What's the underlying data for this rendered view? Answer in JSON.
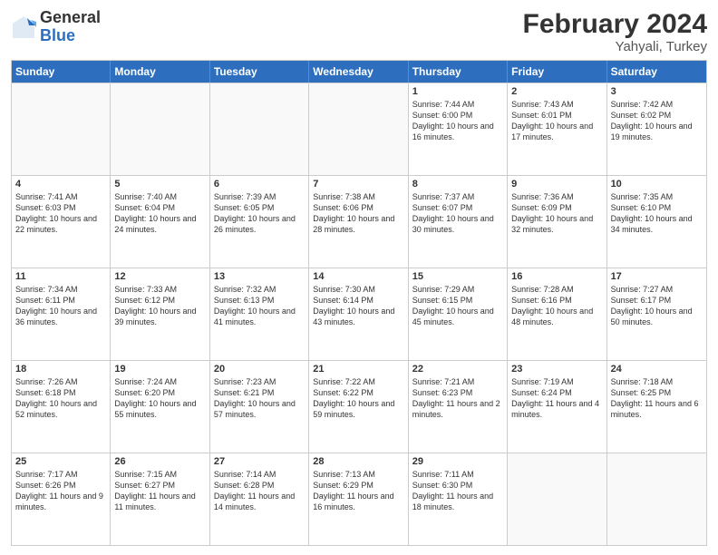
{
  "header": {
    "logo_general": "General",
    "logo_blue": "Blue",
    "cal_title": "February 2024",
    "cal_subtitle": "Yahyali, Turkey"
  },
  "weekdays": [
    "Sunday",
    "Monday",
    "Tuesday",
    "Wednesday",
    "Thursday",
    "Friday",
    "Saturday"
  ],
  "rows": [
    [
      {
        "day": "",
        "text": ""
      },
      {
        "day": "",
        "text": ""
      },
      {
        "day": "",
        "text": ""
      },
      {
        "day": "",
        "text": ""
      },
      {
        "day": "1",
        "text": "Sunrise: 7:44 AM\nSunset: 6:00 PM\nDaylight: 10 hours and 16 minutes."
      },
      {
        "day": "2",
        "text": "Sunrise: 7:43 AM\nSunset: 6:01 PM\nDaylight: 10 hours and 17 minutes."
      },
      {
        "day": "3",
        "text": "Sunrise: 7:42 AM\nSunset: 6:02 PM\nDaylight: 10 hours and 19 minutes."
      }
    ],
    [
      {
        "day": "4",
        "text": "Sunrise: 7:41 AM\nSunset: 6:03 PM\nDaylight: 10 hours and 22 minutes."
      },
      {
        "day": "5",
        "text": "Sunrise: 7:40 AM\nSunset: 6:04 PM\nDaylight: 10 hours and 24 minutes."
      },
      {
        "day": "6",
        "text": "Sunrise: 7:39 AM\nSunset: 6:05 PM\nDaylight: 10 hours and 26 minutes."
      },
      {
        "day": "7",
        "text": "Sunrise: 7:38 AM\nSunset: 6:06 PM\nDaylight: 10 hours and 28 minutes."
      },
      {
        "day": "8",
        "text": "Sunrise: 7:37 AM\nSunset: 6:07 PM\nDaylight: 10 hours and 30 minutes."
      },
      {
        "day": "9",
        "text": "Sunrise: 7:36 AM\nSunset: 6:09 PM\nDaylight: 10 hours and 32 minutes."
      },
      {
        "day": "10",
        "text": "Sunrise: 7:35 AM\nSunset: 6:10 PM\nDaylight: 10 hours and 34 minutes."
      }
    ],
    [
      {
        "day": "11",
        "text": "Sunrise: 7:34 AM\nSunset: 6:11 PM\nDaylight: 10 hours and 36 minutes."
      },
      {
        "day": "12",
        "text": "Sunrise: 7:33 AM\nSunset: 6:12 PM\nDaylight: 10 hours and 39 minutes."
      },
      {
        "day": "13",
        "text": "Sunrise: 7:32 AM\nSunset: 6:13 PM\nDaylight: 10 hours and 41 minutes."
      },
      {
        "day": "14",
        "text": "Sunrise: 7:30 AM\nSunset: 6:14 PM\nDaylight: 10 hours and 43 minutes."
      },
      {
        "day": "15",
        "text": "Sunrise: 7:29 AM\nSunset: 6:15 PM\nDaylight: 10 hours and 45 minutes."
      },
      {
        "day": "16",
        "text": "Sunrise: 7:28 AM\nSunset: 6:16 PM\nDaylight: 10 hours and 48 minutes."
      },
      {
        "day": "17",
        "text": "Sunrise: 7:27 AM\nSunset: 6:17 PM\nDaylight: 10 hours and 50 minutes."
      }
    ],
    [
      {
        "day": "18",
        "text": "Sunrise: 7:26 AM\nSunset: 6:18 PM\nDaylight: 10 hours and 52 minutes."
      },
      {
        "day": "19",
        "text": "Sunrise: 7:24 AM\nSunset: 6:20 PM\nDaylight: 10 hours and 55 minutes."
      },
      {
        "day": "20",
        "text": "Sunrise: 7:23 AM\nSunset: 6:21 PM\nDaylight: 10 hours and 57 minutes."
      },
      {
        "day": "21",
        "text": "Sunrise: 7:22 AM\nSunset: 6:22 PM\nDaylight: 10 hours and 59 minutes."
      },
      {
        "day": "22",
        "text": "Sunrise: 7:21 AM\nSunset: 6:23 PM\nDaylight: 11 hours and 2 minutes."
      },
      {
        "day": "23",
        "text": "Sunrise: 7:19 AM\nSunset: 6:24 PM\nDaylight: 11 hours and 4 minutes."
      },
      {
        "day": "24",
        "text": "Sunrise: 7:18 AM\nSunset: 6:25 PM\nDaylight: 11 hours and 6 minutes."
      }
    ],
    [
      {
        "day": "25",
        "text": "Sunrise: 7:17 AM\nSunset: 6:26 PM\nDaylight: 11 hours and 9 minutes."
      },
      {
        "day": "26",
        "text": "Sunrise: 7:15 AM\nSunset: 6:27 PM\nDaylight: 11 hours and 11 minutes."
      },
      {
        "day": "27",
        "text": "Sunrise: 7:14 AM\nSunset: 6:28 PM\nDaylight: 11 hours and 14 minutes."
      },
      {
        "day": "28",
        "text": "Sunrise: 7:13 AM\nSunset: 6:29 PM\nDaylight: 11 hours and 16 minutes."
      },
      {
        "day": "29",
        "text": "Sunrise: 7:11 AM\nSunset: 6:30 PM\nDaylight: 11 hours and 18 minutes."
      },
      {
        "day": "",
        "text": ""
      },
      {
        "day": "",
        "text": ""
      }
    ]
  ]
}
